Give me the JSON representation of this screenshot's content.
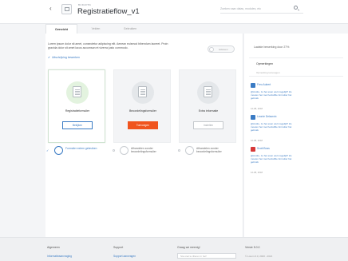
{
  "header": {
    "breadcrumb": "BUDAPPA",
    "title": "Registratieflow_v1",
    "search_placeholder": "Zoeken naar datas, modules, etc"
  },
  "tabs": [
    {
      "label": "Overzicht"
    },
    {
      "label": "Velden"
    },
    {
      "label": "Gebruiken"
    }
  ],
  "main": {
    "description": "Lorem ipsum dolor sit amet, consectetur adipiscing elit. Aenean euismod bibendum laoreet. Proin gravida dolor sit amet lacus accumsan et viverra justo commodo.",
    "toggle_label": "Actieven",
    "explain_link": "Uitschrijving bewerken",
    "cards": [
      {
        "name": "Registratieformulier",
        "button": "Bekijken"
      },
      {
        "name": "Beoordelingsformulier",
        "button": "Toevoegen"
      },
      {
        "name": "Extra informatie",
        "button": "Instellen"
      }
    ],
    "options": [
      {
        "label": "Formulier extern gebruiken"
      },
      {
        "label": "Afhandelen zonder beoordelingsformulier"
      },
      {
        "label": "Afhandelen zonder beoordelingsformulier"
      }
    ]
  },
  "sidebar": {
    "history": "Laatste bewerking door 27%",
    "remarks_title": "Opmerkingen",
    "remarks_placeholder": "Opmerking toevoegen",
    "comments": [
      {
        "name": "Freu Aubert",
        "text": "@Andre, zo het even wel mogelijk? Ze moeten het met hetzelfde formulier het gebruik",
        "date": "12-08, 2018",
        "color": "#3a7bc4"
      },
      {
        "name": "Leonie Delacroix",
        "text": "@Andre, zo het even wel mogelijk? Ze moeten het met hetzelfde formulier het gebruik",
        "date": "12-08, 2018",
        "color": "#3a7bc4"
      },
      {
        "name": "Scott Boss",
        "text": "@Andre, zo het even wel mogelijk? Ze moeten het met hetzelfde formulier het gebruik",
        "date": "12-08, 2018",
        "color": "#d63838"
      }
    ]
  },
  "footer": {
    "col1_title": "Algemeen",
    "col1_link": "Informatieaanvraging",
    "col2_title": "Support",
    "col2_link": "Support aanvragen",
    "col3_title": "Graag we meenig!",
    "col3_placeholder": "Sta snel te tilleren in het!",
    "col4_title": "Versie 5.0.0",
    "col4_text": "© Lorem 0.0, 2020 - 2021"
  }
}
